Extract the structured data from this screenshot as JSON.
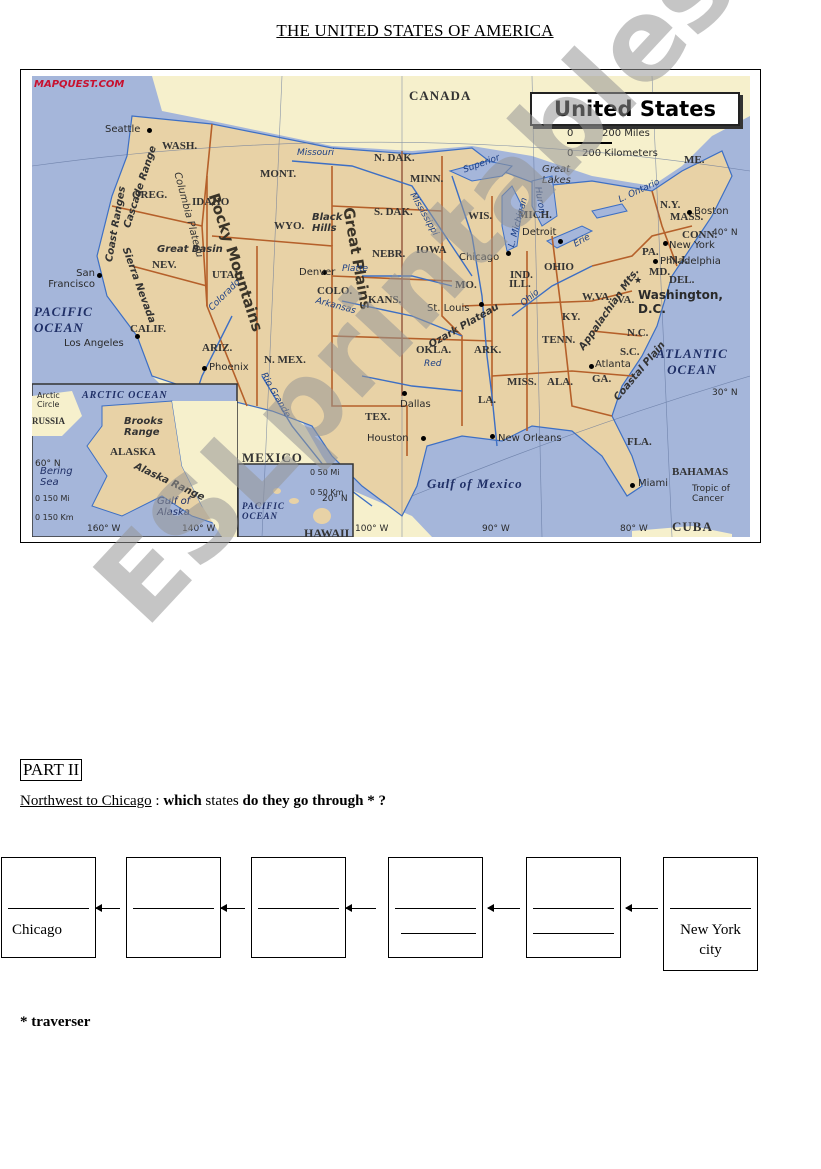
{
  "document": {
    "title": "THE UNITED STATES OF AMERICA",
    "watermark": "ESLprintables.com"
  },
  "map": {
    "source_logo": "MAPQUEST.COM",
    "title": "United States",
    "scale": {
      "miles": "200 Miles",
      "km": "200 Kilometers",
      "zero": "0"
    },
    "colors": {
      "ocean": "#a5b6da",
      "us_land": "#e8d2a6",
      "foreign_land": "#f6f0cc",
      "state_border": "#b5602a",
      "river": "#3d6fc4"
    },
    "countries": [
      "CANADA",
      "MEXICO",
      "CUBA",
      "BAHAMAS",
      "RUSSIA"
    ],
    "oceans": [
      "PACIFIC OCEAN",
      "ATLANTIC OCEAN",
      "ARCTIC OCEAN",
      "Gulf of Mexico",
      "Gulf of Alaska",
      "Bering Sea"
    ],
    "states": [
      "WASH.",
      "OREG.",
      "CALIF.",
      "NEV.",
      "IDAHO",
      "MONT.",
      "WYO.",
      "UTAH",
      "ARIZ.",
      "N. MEX.",
      "COLO.",
      "N. DAK.",
      "S. DAK.",
      "NEBR.",
      "KANS.",
      "OKLA.",
      "TEX.",
      "MINN.",
      "IOWA",
      "MO.",
      "ARK.",
      "LA.",
      "WIS.",
      "ILL.",
      "MICH.",
      "IND.",
      "OHIO",
      "KY.",
      "TENN.",
      "MISS.",
      "ALA.",
      "GA.",
      "FLA.",
      "S.C.",
      "N.C.",
      "VA.",
      "W.VA.",
      "PA.",
      "N.Y.",
      "ME.",
      "MASS.",
      "CONN.",
      "N.J.",
      "DEL.",
      "MD.",
      "ALASKA",
      "HAWAII"
    ],
    "cities": [
      "Seattle",
      "San Francisco",
      "Los Angeles",
      "Phoenix",
      "Denver",
      "Dallas",
      "Houston",
      "St. Louis",
      "Chicago",
      "Detroit",
      "New Orleans",
      "Atlanta",
      "Miami",
      "Washington, D.C.",
      "Philadelphia",
      "New York",
      "Boston"
    ],
    "features": [
      "Rocky Mountains",
      "Great Plains",
      "Great Basin",
      "Columbia Plateau",
      "Coast Ranges",
      "Cascade Range",
      "Sierra Nevada",
      "Black Hills",
      "Great Lakes",
      "Ozark Plateau",
      "Appalachian Mts.",
      "Coastal Plain",
      "Brooks Range",
      "Alaska Range",
      "Arctic Circle",
      "Tropic of Cancer"
    ],
    "rivers": [
      "Missouri",
      "Mississippi",
      "Platte",
      "Arkansas",
      "Colorado",
      "Rio Grande",
      "Red",
      "Ohio",
      "Superior",
      "L. Michigan",
      "Huron",
      "Erie",
      "L. Ontario"
    ],
    "gridlines": [
      "40° N",
      "30° N",
      "20° N",
      "60° N",
      "160° W",
      "140° W",
      "100° W",
      "90° W",
      "80° W"
    ],
    "inset_scales": {
      "alaska_mi": "0  150 Mi",
      "alaska_km": "0 150 Km",
      "hawaii_mi": "0  50 Mi",
      "hawaii_km": "0 50 Km"
    }
  },
  "part2": {
    "heading": "PART II",
    "question_underlined": "Northwest to Chicago",
    "question_sep": " : ",
    "question_b1": "which",
    "question_mid": " states ",
    "question_b2": "do they go through * ?",
    "route": {
      "start_city": "Chicago",
      "end_city_line1": "New York",
      "end_city_line2": "city",
      "boxes": [
        {
          "label": "Chicago",
          "blank_lines": 1
        },
        {
          "label": "",
          "blank_lines": 1
        },
        {
          "label": "",
          "blank_lines": 1
        },
        {
          "label": "",
          "blank_lines": 2
        },
        {
          "label": "",
          "blank_lines": 2
        },
        {
          "label": "New York city",
          "blank_lines": 1
        }
      ]
    },
    "footnote": "* traverser"
  }
}
